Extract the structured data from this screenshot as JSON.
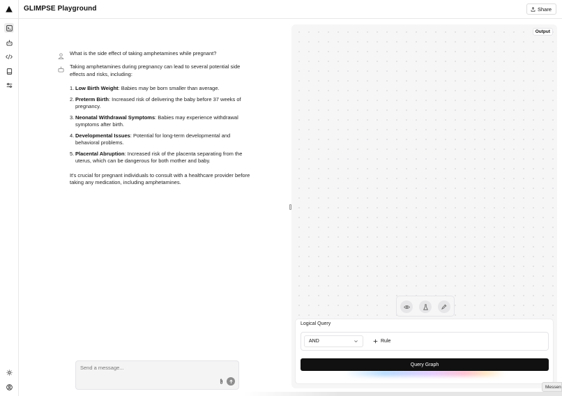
{
  "app": {
    "title": "GLIMPSE Playground",
    "share_label": "Share"
  },
  "rail": {
    "items": [
      {
        "icon": "terminal-icon",
        "active": true
      },
      {
        "icon": "bot-icon",
        "active": false
      },
      {
        "icon": "code-icon",
        "active": false
      },
      {
        "icon": "book-icon",
        "active": false
      },
      {
        "icon": "sliders-icon",
        "active": false
      }
    ],
    "bottom": [
      {
        "icon": "sun-icon"
      },
      {
        "icon": "user-circle-icon"
      }
    ]
  },
  "chat": {
    "user_message": "What is the side effect of taking amphetamines while pregnant?",
    "assistant": {
      "intro": "Taking amphetamines during pregnancy can lead to several potential side effects and risks, including:",
      "items": [
        {
          "num": "1.",
          "title": "Low Birth Weight",
          "text": ": Babies may be born smaller than average."
        },
        {
          "num": "2.",
          "title": "Preterm Birth",
          "text": ": Increased risk of delivering the baby before 37 weeks of pregnancy."
        },
        {
          "num": "3.",
          "title": "Neonatal Withdrawal Symptoms",
          "text": ": Babies may experience withdrawal symptoms after birth."
        },
        {
          "num": "4.",
          "title": "Developmental Issues",
          "text": ": Potential for long-term developmental and behavioral problems."
        },
        {
          "num": "5.",
          "title": "Placental Abruption",
          "text": ": Increased risk of the placenta separating from the uterus, which can be dangerous for both mother and baby."
        }
      ],
      "closing": "It's crucial for pregnant individuals to consult with a healthcare provider before taking any medication, including amphetamines."
    },
    "composer": {
      "placeholder": "Send a message..."
    }
  },
  "output": {
    "label": "Output",
    "tools": [
      {
        "icon": "eye-icon"
      },
      {
        "icon": "flask-icon"
      },
      {
        "icon": "pipette-icon"
      }
    ],
    "query": {
      "title": "Logical Query",
      "operator": "AND",
      "rule_label": "Rule",
      "submit_label": "Query Graph"
    }
  },
  "messenger_label": "Messenger"
}
